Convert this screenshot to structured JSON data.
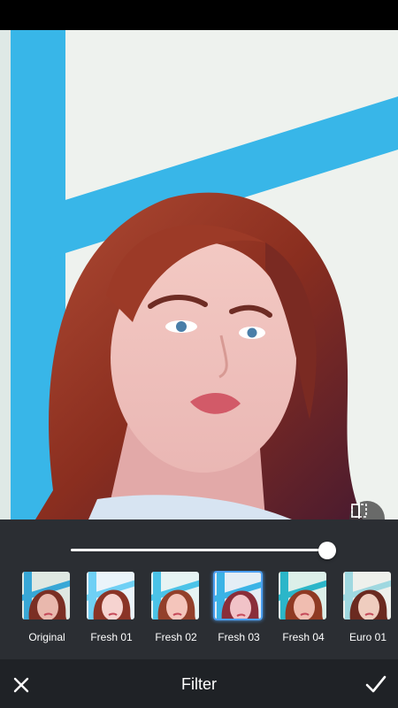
{
  "header": {
    "title": "Filter"
  },
  "toolbar": {
    "close_icon": "close-icon",
    "confirm_icon": "check-icon"
  },
  "photo": {
    "compare_icon": "compare-icon"
  },
  "intensity": {
    "value": 1.0
  },
  "filters": [
    {
      "label": "Original",
      "selected": false
    },
    {
      "label": "Fresh 01",
      "selected": false
    },
    {
      "label": "Fresh 02",
      "selected": false
    },
    {
      "label": "Fresh 03",
      "selected": true
    },
    {
      "label": "Fresh 04",
      "selected": false
    },
    {
      "label": "Euro 01",
      "selected": false
    }
  ],
  "colors": {
    "accent": "#4b9ef0",
    "panel": "#2b2e33",
    "bottom_bar": "#1f2226",
    "frame_blue": "#38b6e8",
    "hair": "#8a2e1f"
  }
}
